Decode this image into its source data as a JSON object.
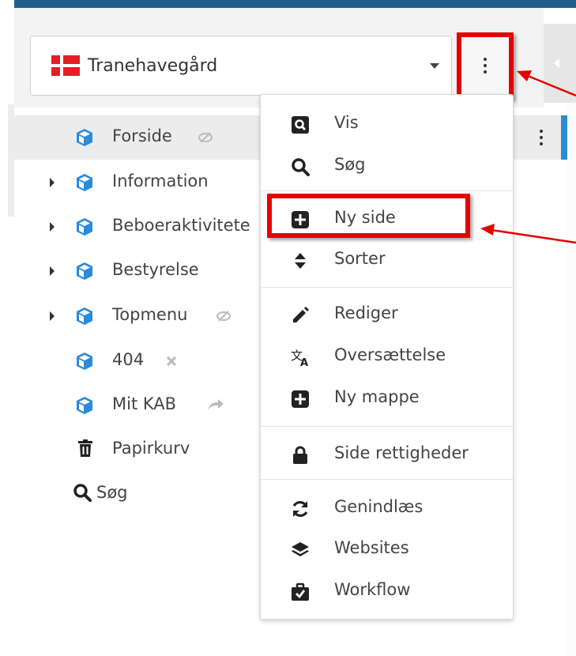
{
  "site_selector": {
    "value": "Tranehavegård",
    "flag_icon": "denmark-flag-icon"
  },
  "tree": {
    "items": [
      {
        "label": "Forside",
        "has_children": false,
        "badge": "hidden-eye-icon"
      },
      {
        "label": "Information",
        "has_children": true
      },
      {
        "label": "Beboeraktivitete",
        "has_children": true
      },
      {
        "label": "Bestyrelse",
        "has_children": true
      },
      {
        "label": "Topmenu",
        "has_children": true,
        "badge": "hidden-eye-icon"
      },
      {
        "label": "404",
        "has_children": false,
        "badge": "x-icon"
      },
      {
        "label": "Mit KAB",
        "has_children": false,
        "badge": "redirect-arrow-icon"
      },
      {
        "label": "Papirkurv",
        "icon": "trash-icon"
      },
      {
        "label": "Søg",
        "icon": "search-icon"
      }
    ]
  },
  "context_menu": {
    "items": [
      {
        "label": "Vis",
        "icon": "view-search-icon"
      },
      {
        "label": "Søg",
        "icon": "search-icon"
      },
      {
        "label": "Ny side",
        "icon": "plus-square-icon"
      },
      {
        "label": "Sorter",
        "icon": "sort-icon"
      },
      {
        "label": "Rediger",
        "icon": "pencil-icon"
      },
      {
        "label": "Oversættelse",
        "icon": "translate-icon"
      },
      {
        "label": "Ny mappe",
        "icon": "plus-square-icon"
      },
      {
        "label": "Side rettigheder",
        "icon": "lock-icon"
      },
      {
        "label": "Genindlæs",
        "icon": "refresh-icon"
      },
      {
        "label": "Websites",
        "icon": "layers-icon"
      },
      {
        "label": "Workflow",
        "icon": "briefcase-check-icon"
      }
    ]
  },
  "colors": {
    "accent": "#2b8bd8",
    "highlight": "#e60000",
    "node_icon": "#2b8bd8",
    "top_bar": "#1f5f8b"
  }
}
